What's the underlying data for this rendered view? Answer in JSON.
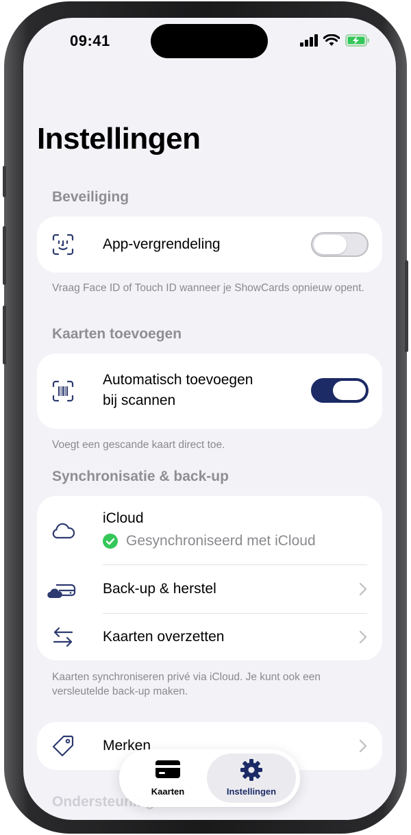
{
  "status_bar": {
    "time": "09:41"
  },
  "page": {
    "title": "Instellingen"
  },
  "sections": {
    "security": {
      "header": "Beveiliging",
      "row_label": "App-vergrendeling",
      "toggle_on": false,
      "footnote": "Vraag Face ID of Touch ID wanneer je ShowCards opnieuw opent."
    },
    "add_cards": {
      "header": "Kaarten toevoegen",
      "row_label_line1": "Automatisch toevoegen",
      "row_label_line2": "bij scannen",
      "toggle_on": true,
      "footnote": "Voegt een gescande kaart direct toe."
    },
    "sync": {
      "header": "Synchronisatie & back-up",
      "icloud_label": "iCloud",
      "icloud_status": "Gesynchroniseerd met iCloud",
      "backup_label": "Back-up & herstel",
      "transfer_label": "Kaarten overzetten",
      "footnote": "Kaarten synchroniseren privé via iCloud. Je kunt ook een versleutelde back-up maken."
    },
    "brands": {
      "row_label": "Merken"
    },
    "support": {
      "header": "Ondersteuning"
    }
  },
  "tabbar": {
    "tabs": [
      {
        "label": "Kaarten",
        "icon": "card-icon",
        "active": false
      },
      {
        "label": "Instellingen",
        "icon": "gear-icon",
        "active": true
      }
    ]
  },
  "colors": {
    "accent": "#1c2b66",
    "background": "#f2f2f7",
    "success": "#34c759",
    "secondary_text": "#8a8a8e",
    "icon": "#2d3a70"
  }
}
